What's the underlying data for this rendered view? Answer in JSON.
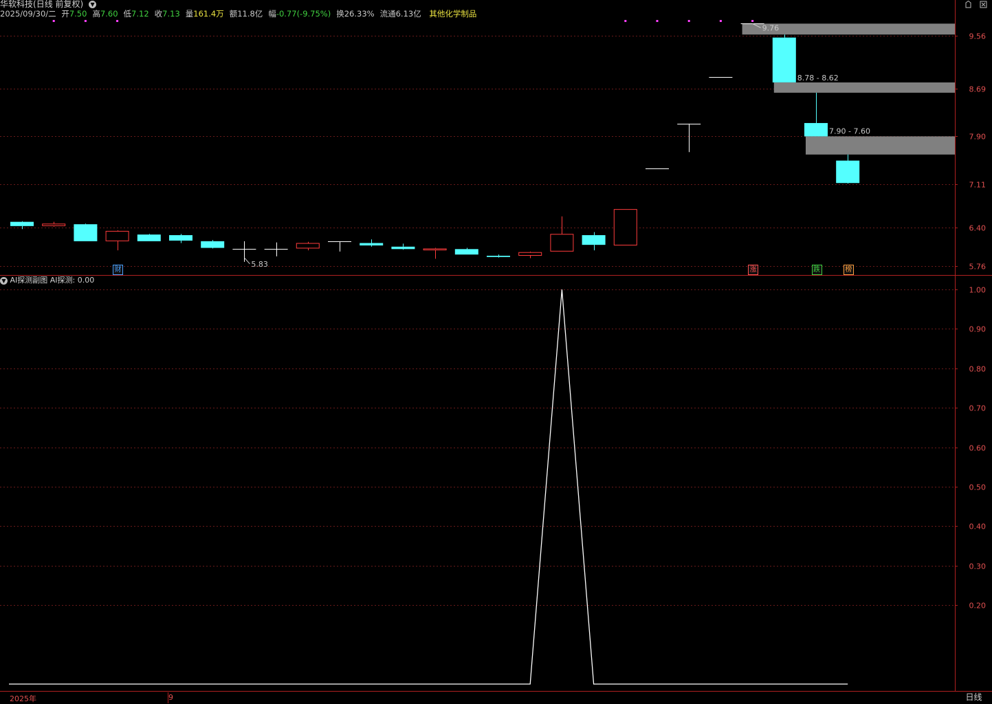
{
  "header": {
    "stock_name": "华软科技",
    "chart_mode": "(日线 前复权)",
    "date": "2025/09/30/二",
    "quote": [
      {
        "label": "开",
        "value": "7.50",
        "color": "#40d040"
      },
      {
        "label": "高",
        "value": "7.60",
        "color": "#40d040"
      },
      {
        "label": "低",
        "value": "7.12",
        "color": "#40d040"
      },
      {
        "label": "收",
        "value": "7.13",
        "color": "#40d040"
      },
      {
        "label": "量",
        "value": "161.4万",
        "color": "#e8e040"
      },
      {
        "label": "额",
        "value": "11.8亿",
        "color": "#c8c8c8"
      },
      {
        "label": "幅",
        "value": "-0.77(-9.75%)",
        "color": "#40d040"
      },
      {
        "label": "换",
        "value": "26.33%",
        "color": "#c8c8c8"
      },
      {
        "label": "流通",
        "value": "6.13亿",
        "color": "#c8c8c8"
      }
    ],
    "industry": "其他化学制品",
    "dropdown_icon": "chevron-down-icon"
  },
  "window_controls": {
    "restore": "restore-icon",
    "close": "close-icon"
  },
  "main_chart": {
    "y_ticks": [
      "9.56",
      "8.69",
      "7.90",
      "7.11",
      "6.40",
      "5.76"
    ],
    "annotations": {
      "high": "9.76",
      "low": "5.83",
      "gap1": "8.78 - 8.62",
      "gap2": "7.90 - 7.60"
    },
    "badges": [
      {
        "text": "财",
        "color": "#4aa0ff"
      },
      {
        "text": "涨",
        "color": "#ff5050"
      },
      {
        "text": "跌",
        "color": "#40d040"
      },
      {
        "text": "榜",
        "color": "#ffa040"
      }
    ]
  },
  "sub_chart": {
    "title": "AI探测副图",
    "indicator_label": "AI探测:",
    "indicator_value": "0.00",
    "y_ticks": [
      "1.00",
      "0.90",
      "0.80",
      "0.70",
      "0.60",
      "0.50",
      "0.40",
      "0.30",
      "0.20"
    ]
  },
  "x_axis": {
    "year_label": "2025年",
    "month_label": "9"
  },
  "period_tab": "日线",
  "chart_data": [
    {
      "type": "candlestick",
      "ylim": [
        5.7,
        9.8
      ],
      "up_color": "#ff3c3c",
      "down_color": "#54ffff",
      "candles": [
        {
          "o": 6.49,
          "h": 6.5,
          "l": 6.37,
          "c": 6.42
        },
        {
          "o": 6.42,
          "h": 6.49,
          "l": 6.41,
          "c": 6.46
        },
        {
          "o": 6.45,
          "h": 6.46,
          "l": 6.17,
          "c": 6.17
        },
        {
          "o": 6.17,
          "h": 6.35,
          "l": 6.02,
          "c": 6.34
        },
        {
          "o": 6.28,
          "h": 6.29,
          "l": 6.17,
          "c": 6.17
        },
        {
          "o": 6.27,
          "h": 6.29,
          "l": 6.14,
          "c": 6.18
        },
        {
          "o": 6.17,
          "h": 6.19,
          "l": 6.05,
          "c": 6.06
        },
        {
          "o": 6.04,
          "h": 6.17,
          "l": 5.83,
          "c": 6.03
        },
        {
          "o": 6.03,
          "h": 6.15,
          "l": 5.92,
          "c": 6.04
        },
        {
          "o": 6.05,
          "h": 6.16,
          "l": 6.02,
          "c": 6.14
        },
        {
          "o": 6.16,
          "h": 6.16,
          "l": 6.0,
          "c": 6.17
        },
        {
          "o": 6.14,
          "h": 6.2,
          "l": 6.08,
          "c": 6.1
        },
        {
          "o": 6.08,
          "h": 6.13,
          "l": 6.03,
          "c": 6.04
        },
        {
          "o": 6.02,
          "h": 6.06,
          "l": 5.88,
          "c": 6.05
        },
        {
          "o": 6.04,
          "h": 6.06,
          "l": 5.95,
          "c": 5.95
        },
        {
          "o": 5.93,
          "h": 5.95,
          "l": 5.9,
          "c": 5.91
        },
        {
          "o": 5.93,
          "h": 6.0,
          "l": 5.89,
          "c": 5.99
        },
        {
          "o": 6.0,
          "h": 6.58,
          "l": 6.0,
          "c": 6.29
        },
        {
          "o": 6.27,
          "h": 6.32,
          "l": 6.02,
          "c": 6.11
        },
        {
          "o": 6.1,
          "h": 6.7,
          "l": 6.1,
          "c": 6.7
        },
        {
          "o": 7.37,
          "h": 7.37,
          "l": 7.37,
          "c": 7.37
        },
        {
          "o": 8.1,
          "h": 8.11,
          "l": 7.64,
          "c": 8.11
        },
        {
          "o": 8.88,
          "h": 8.88,
          "l": 8.88,
          "c": 8.88
        },
        {
          "o": 9.76,
          "h": 9.76,
          "l": 9.76,
          "c": 9.76
        },
        {
          "o": 9.53,
          "h": 9.58,
          "l": 8.79,
          "c": 8.79
        },
        {
          "o": 8.12,
          "h": 8.62,
          "l": 7.9,
          "c": 7.9
        },
        {
          "o": 7.5,
          "h": 7.6,
          "l": 7.12,
          "c": 7.13
        }
      ]
    },
    {
      "type": "line",
      "title": "AI探测副图",
      "ylim": [
        0,
        1
      ],
      "values": [
        0,
        0,
        0,
        0,
        0,
        0,
        0,
        0,
        0,
        0,
        0,
        0,
        0,
        0,
        0,
        0,
        0,
        1,
        0,
        0,
        0,
        0,
        0,
        0,
        0,
        0,
        0
      ]
    }
  ]
}
